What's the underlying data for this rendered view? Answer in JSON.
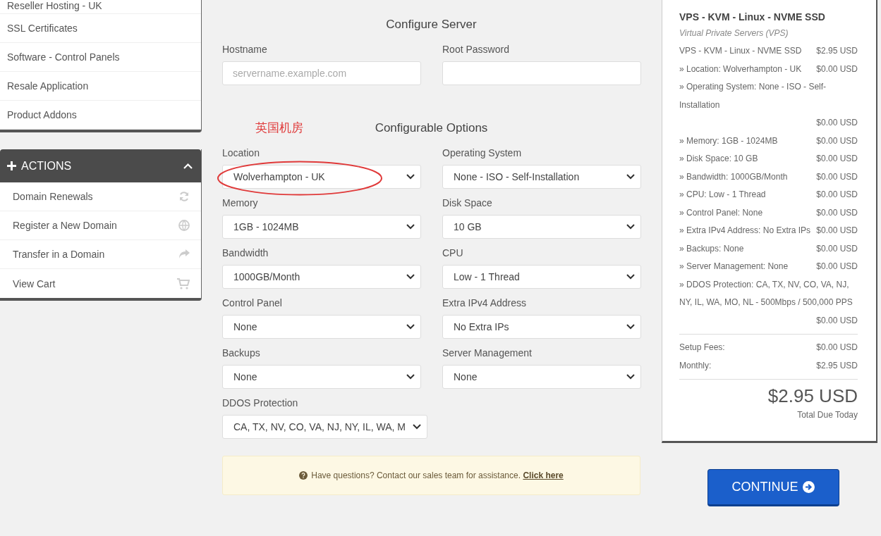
{
  "sidebar": {
    "categories": [
      {
        "label": "Reseller Hosting - UK"
      },
      {
        "label": "SSL Certificates"
      },
      {
        "label": "Software - Control Panels"
      },
      {
        "label": "Resale Application"
      },
      {
        "label": "Product Addons"
      }
    ],
    "actions": {
      "title": "ACTIONS",
      "expanded": true,
      "items": [
        {
          "label": "Domain Renewals"
        },
        {
          "label": "Register a New Domain"
        },
        {
          "label": "Transfer in a Domain"
        },
        {
          "label": "View Cart"
        }
      ]
    }
  },
  "configure_server": {
    "title": "Configure Server",
    "fields": [
      {
        "label": "Hostname",
        "kind": "input",
        "placeholder": "servername.example.com"
      },
      {
        "label": "Root Password",
        "kind": "input"
      }
    ]
  },
  "annotation": {
    "text": "英国机房"
  },
  "configurable_options": {
    "title": "Configurable Options",
    "fields": [
      {
        "label": "Location",
        "kind": "select",
        "value": "Wolverhampton - UK"
      },
      {
        "label": "Operating System",
        "kind": "select",
        "value": "None - ISO - Self-Installation"
      },
      {
        "label": "Memory",
        "kind": "select",
        "value": "1GB - 1024MB"
      },
      {
        "label": "Disk Space",
        "kind": "select",
        "value": "10 GB"
      },
      {
        "label": "Bandwidth",
        "kind": "select",
        "value": "1000GB/Month"
      },
      {
        "label": "CPU",
        "kind": "select",
        "value": "Low - 1 Thread"
      },
      {
        "label": "Control Panel",
        "kind": "select",
        "value": "None"
      },
      {
        "label": "Extra IPv4 Address",
        "kind": "select",
        "value": "No Extra IPs"
      },
      {
        "label": "Backups",
        "kind": "select",
        "value": "None"
      },
      {
        "label": "Server Management",
        "kind": "select",
        "value": "None"
      },
      {
        "label": "DDOS Protection",
        "kind": "select",
        "value": "CA, TX, NV, CO, VA, NJ, NY, IL, WA, M"
      }
    ]
  },
  "notice": {
    "text": "Have questions? Contact our sales team for assistance.",
    "link": "Click here"
  },
  "summary": {
    "product": "VPS - KVM - Linux - NVME SSD",
    "group": "Virtual Private Servers (VPS)",
    "lines": [
      {
        "label": "VPS - KVM - Linux - NVME SSD",
        "price": "$2.95 USD"
      },
      {
        "label": "» Location: Wolverhampton - UK",
        "price": "$0.00 USD"
      },
      {
        "label": "» Operating System: None - ISO - Self-Installation",
        "price": "$0.00 USD"
      },
      {
        "label": "» Memory: 1GB - 1024MB",
        "price": "$0.00 USD"
      },
      {
        "label": "» Disk Space: 10 GB",
        "price": "$0.00 USD"
      },
      {
        "label": "» Bandwidth: 1000GB/Month",
        "price": "$0.00 USD"
      },
      {
        "label": "» CPU: Low - 1 Thread",
        "price": "$0.00 USD"
      },
      {
        "label": "» Control Panel: None",
        "price": "$0.00 USD"
      },
      {
        "label": "» Extra IPv4 Address: No Extra IPs",
        "price": "$0.00 USD"
      },
      {
        "label": "» Backups: None",
        "price": "$0.00 USD"
      },
      {
        "label": "» Server Management: None",
        "price": "$0.00 USD"
      },
      {
        "label": "» DDOS Protection: CA, TX, NV, CO, VA, NJ, NY, IL, WA, MO, NL - 500Mbps / 500,000 PPS",
        "price": "$0.00 USD"
      }
    ],
    "totals": [
      {
        "label": "Setup Fees:",
        "price": "$0.00 USD"
      },
      {
        "label": "Monthly:",
        "price": "$2.95 USD"
      }
    ],
    "total": "$2.95 USD",
    "total_label": "Total Due Today"
  },
  "continue_button": {
    "label": "CONTINUE"
  }
}
